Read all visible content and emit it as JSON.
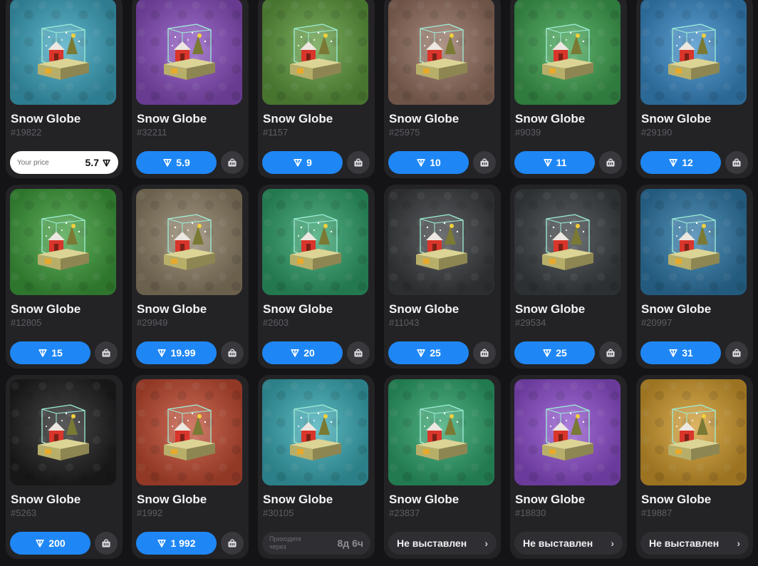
{
  "cards": [
    {
      "title": "Snow Globe",
      "number": "#19822",
      "bg": "#3ea6c0",
      "mode": "yourprice",
      "price_label": "Your price",
      "price": "5.7"
    },
    {
      "title": "Snow Globe",
      "number": "#32211",
      "bg": "#8a4fc0",
      "mode": "buy",
      "price": "5.9"
    },
    {
      "title": "Snow Globe",
      "number": "#1157",
      "bg": "#5f9b3e",
      "mode": "buy",
      "price": "9"
    },
    {
      "title": "Snow Globe",
      "number": "#25975",
      "bg": "#93705f",
      "mode": "buy",
      "price": "10"
    },
    {
      "title": "Snow Globe",
      "number": "#9039",
      "bg": "#3fa351",
      "mode": "buy",
      "price": "11"
    },
    {
      "title": "Snow Globe",
      "number": "#29190",
      "bg": "#3a8bc8",
      "mode": "buy",
      "price": "12"
    },
    {
      "title": "Snow Globe",
      "number": "#12805",
      "bg": "#3e9e3c",
      "mode": "buy",
      "price": "15"
    },
    {
      "title": "Snow Globe",
      "number": "#29949",
      "bg": "#8e8066",
      "mode": "buy",
      "price": "19.99"
    },
    {
      "title": "Snow Globe",
      "number": "#2603",
      "bg": "#2fa06a",
      "mode": "buy",
      "price": "20"
    },
    {
      "title": "Snow Globe",
      "number": "#11043",
      "bg": "#3a3d40",
      "mode": "buy",
      "price": "25"
    },
    {
      "title": "Snow Globe",
      "number": "#29534",
      "bg": "#3b4043",
      "mode": "buy",
      "price": "25"
    },
    {
      "title": "Snow Globe",
      "number": "#20997",
      "bg": "#2f79a8",
      "mode": "buy",
      "price": "31"
    },
    {
      "title": "Snow Globe",
      "number": "#5263",
      "bg": "#1f1f20",
      "mode": "buy",
      "price": "200"
    },
    {
      "title": "Snow Globe",
      "number": "#1992",
      "bg": "#c24b32",
      "mode": "buy",
      "price": "1 992"
    },
    {
      "title": "Snow Globe",
      "number": "#30105",
      "bg": "#3aaab5",
      "mode": "countdown",
      "countdown_label": "Приходите через",
      "countdown": "8д 6ч"
    },
    {
      "title": "Snow Globe",
      "number": "#23837",
      "bg": "#2ea36b",
      "mode": "notlisted",
      "status": "Не выставлен"
    },
    {
      "title": "Snow Globe",
      "number": "#18830",
      "bg": "#8f4fcf",
      "mode": "notlisted",
      "status": "Не выставлен"
    },
    {
      "title": "Snow Globe",
      "number": "#19887",
      "bg": "#d09a2c",
      "mode": "notlisted",
      "status": "Не выставлен"
    }
  ],
  "icons": {
    "currency": "ton-icon",
    "cart": "cart-icon",
    "chevron": "chevron-right-icon"
  }
}
